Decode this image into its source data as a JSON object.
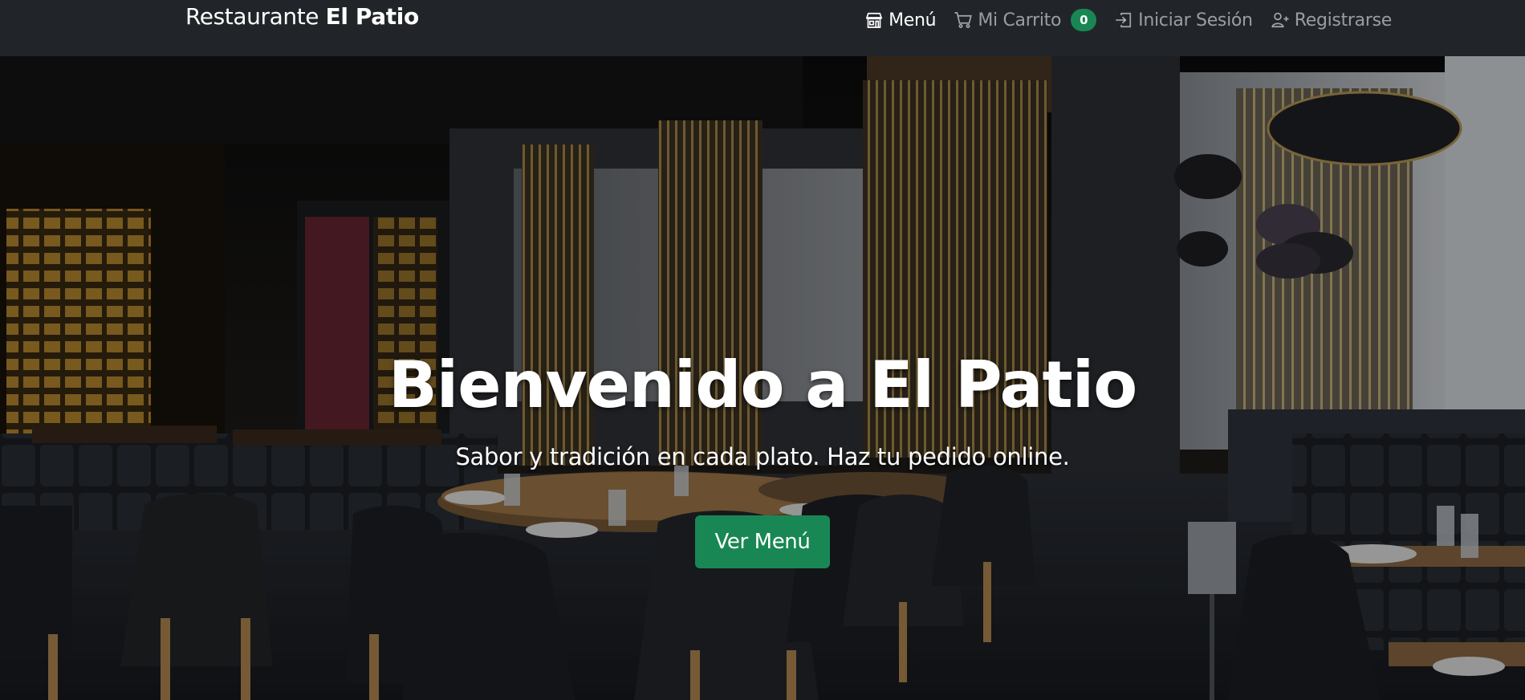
{
  "navbar": {
    "brand_prefix": "Restaurante ",
    "brand_name": "El Patio",
    "links": [
      {
        "label": "Menú",
        "icon": "shop-icon",
        "active": true
      },
      {
        "label": "Mi Carrito",
        "icon": "cart-icon",
        "active": false,
        "badge": "0"
      },
      {
        "label": "Iniciar Sesión",
        "icon": "login-icon",
        "active": false
      },
      {
        "label": "Registrarse",
        "icon": "person-plus-icon",
        "active": false
      }
    ]
  },
  "hero": {
    "title": "Bienvenido a El Patio",
    "subtitle": "Sabor y tradición en cada plato. Haz tu pedido online.",
    "button_label": "Ver Menú"
  },
  "colors": {
    "navbar_bg": "#212529",
    "accent_green": "#198754",
    "text_white": "#ffffff",
    "text_muted": "rgba(255,255,255,0.55)"
  }
}
